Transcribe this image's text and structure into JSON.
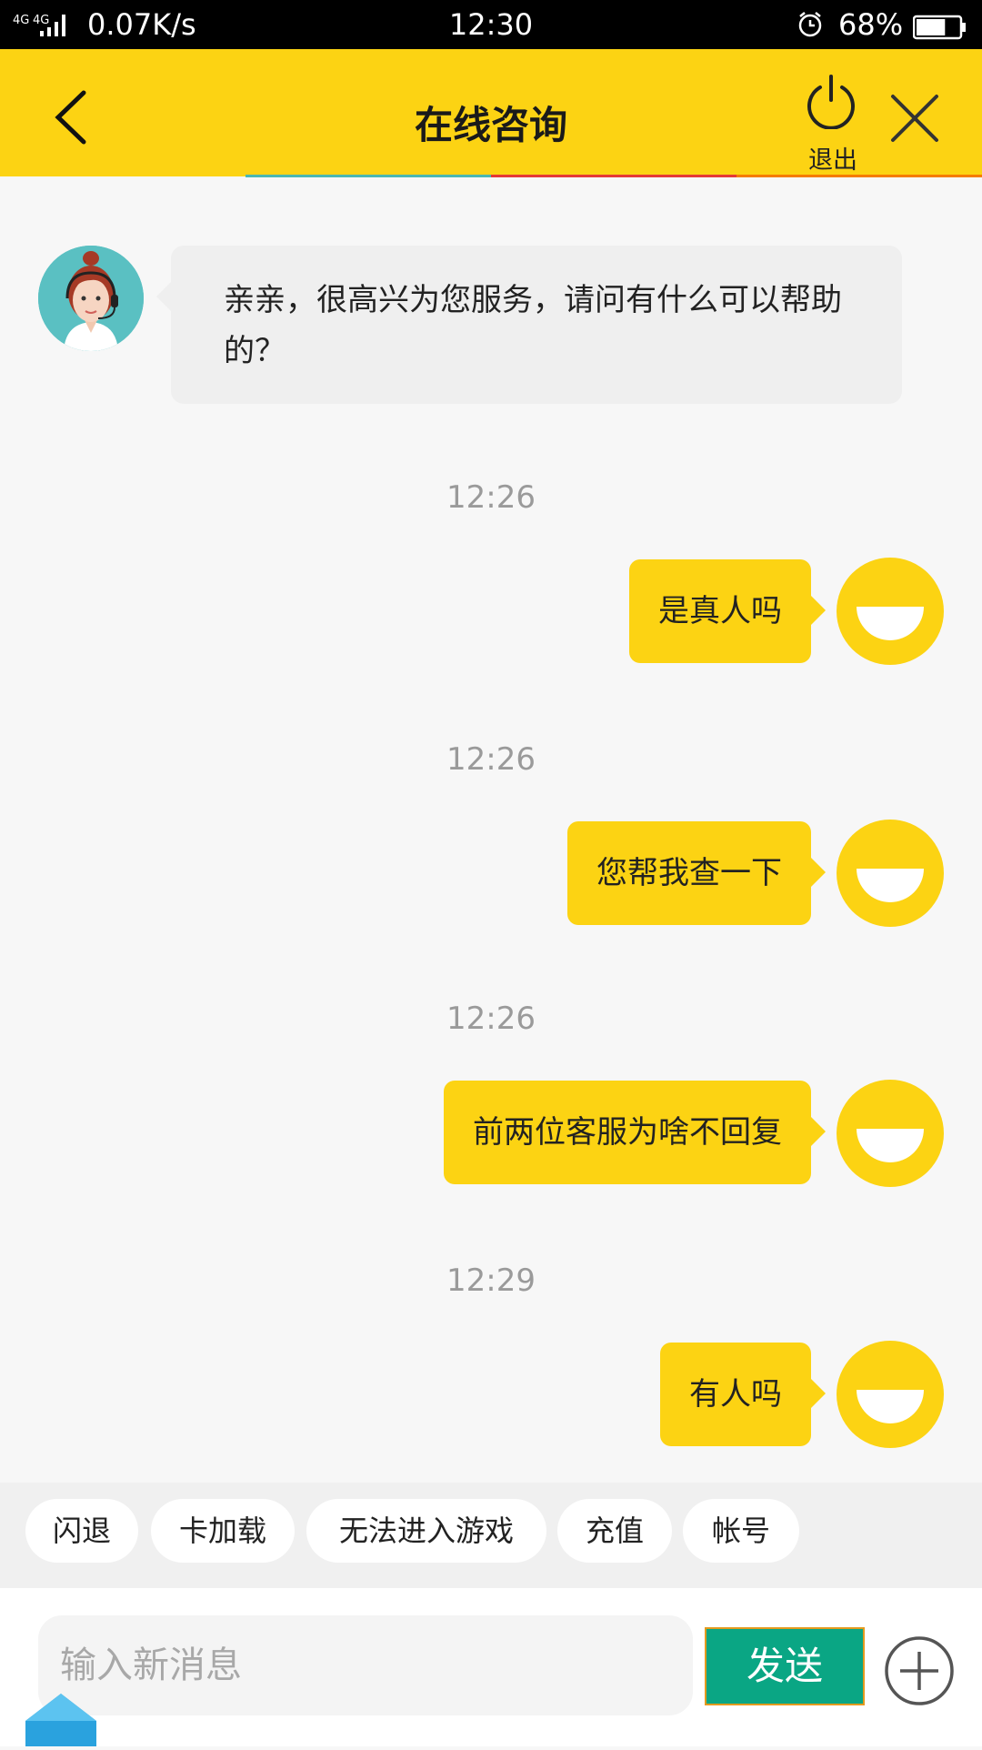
{
  "status_bar": {
    "signal": "4G 4G",
    "net_speed": "0.07K/s",
    "time": "12:30",
    "battery": "68%",
    "battery_level": 0.68
  },
  "header": {
    "title": "在线咨询",
    "exit_label": "退出",
    "accent_color": "#fcd313"
  },
  "chat": {
    "agent_message": "亲亲，很高兴为您服务，请问有什么可以帮助的？",
    "messages": [
      {
        "time": "12:26",
        "text": "是真人吗"
      },
      {
        "time": "12:26",
        "text": "您帮我查一下"
      },
      {
        "time": "12:26",
        "text": "前两位客服为啥不回复"
      },
      {
        "time": "12:29",
        "text": "有人吗"
      }
    ]
  },
  "quick_replies": [
    "闪退",
    "卡加载",
    "无法进入游戏",
    "充值",
    "帐号"
  ],
  "input": {
    "placeholder": "输入新消息",
    "send_label": "发送",
    "send_color": "#0aa684"
  }
}
